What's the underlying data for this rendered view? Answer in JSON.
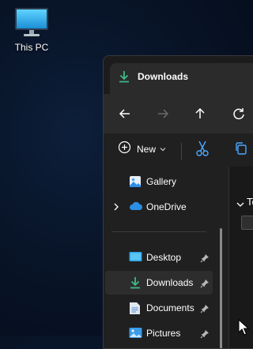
{
  "desktop": {
    "icons": [
      {
        "label": "This PC",
        "icon": "monitor-icon"
      }
    ]
  },
  "window": {
    "tab_title": "Downloads",
    "tab_icon": "download-arrow-icon",
    "nav": {
      "back": "back-arrow-icon",
      "forward": "forward-arrow-icon",
      "up": "up-arrow-icon",
      "refresh": "refresh-icon"
    },
    "toolbar": {
      "new_label": "New",
      "cut_icon": "scissors-icon",
      "copy_icon": "copy-icon"
    },
    "sidebar": {
      "items": [
        {
          "label": "Gallery",
          "icon": "gallery-icon",
          "pinned": false,
          "expandable": false,
          "selected": false
        },
        {
          "label": "OneDrive",
          "icon": "cloud-icon",
          "pinned": false,
          "expandable": true,
          "selected": false
        },
        {
          "label": "Desktop",
          "icon": "desktop-folder-icon",
          "pinned": true,
          "expandable": false,
          "selected": false
        },
        {
          "label": "Downloads",
          "icon": "download-arrow-icon",
          "pinned": true,
          "expandable": false,
          "selected": true
        },
        {
          "label": "Documents",
          "icon": "documents-icon",
          "pinned": true,
          "expandable": false,
          "selected": false
        },
        {
          "label": "Pictures",
          "icon": "pictures-icon",
          "pinned": true,
          "expandable": false,
          "selected": false
        }
      ]
    },
    "content": {
      "group_label": "To"
    }
  },
  "colors": {
    "accent": "#3fb98a",
    "onedrive": "#2b8fe6",
    "window_bg": "#202020"
  }
}
